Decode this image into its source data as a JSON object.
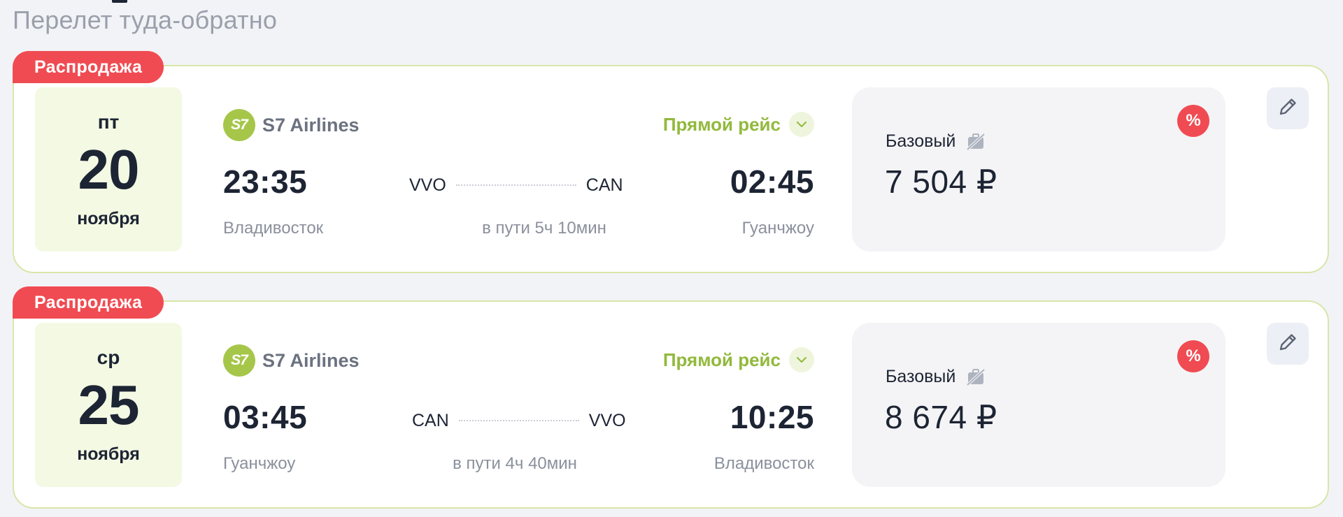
{
  "header": {
    "subtitle": "Перелет туда-обратно"
  },
  "flights": [
    {
      "badge": "Распродажа",
      "date": {
        "weekday": "пт",
        "day": "20",
        "month": "ноября"
      },
      "airline": {
        "logo_text": "S7",
        "name": "S7 Airlines"
      },
      "flight_type": "Прямой рейс",
      "departure": {
        "time": "23:35",
        "city": "Владивосток",
        "code": "VVO"
      },
      "arrival": {
        "time": "02:45",
        "city": "Гуанчжоу",
        "code": "CAN"
      },
      "duration": "в пути 5ч 10мин",
      "fare": {
        "name": "Базовый",
        "price": "7 504 ₽",
        "discount_symbol": "%"
      }
    },
    {
      "badge": "Распродажа",
      "date": {
        "weekday": "ср",
        "day": "25",
        "month": "ноября"
      },
      "airline": {
        "logo_text": "S7",
        "name": "S7 Airlines"
      },
      "flight_type": "Прямой рейс",
      "departure": {
        "time": "03:45",
        "city": "Гуанчжоу",
        "code": "CAN"
      },
      "arrival": {
        "time": "10:25",
        "city": "Владивосток",
        "code": "VVO"
      },
      "duration": "в пути 4ч 40мин",
      "fare": {
        "name": "Базовый",
        "price": "8 674 ₽",
        "discount_symbol": "%"
      }
    }
  ],
  "icons": {
    "chevron": "chevron-down-icon",
    "no_baggage": "no-baggage-icon",
    "edit": "pencil-icon"
  },
  "colors": {
    "sale": "#f04b52",
    "accent_green": "#92b93c",
    "airline_logo": "#a6c64a",
    "card_border": "#d8e6a8",
    "date_bg": "#f3f9e3"
  }
}
